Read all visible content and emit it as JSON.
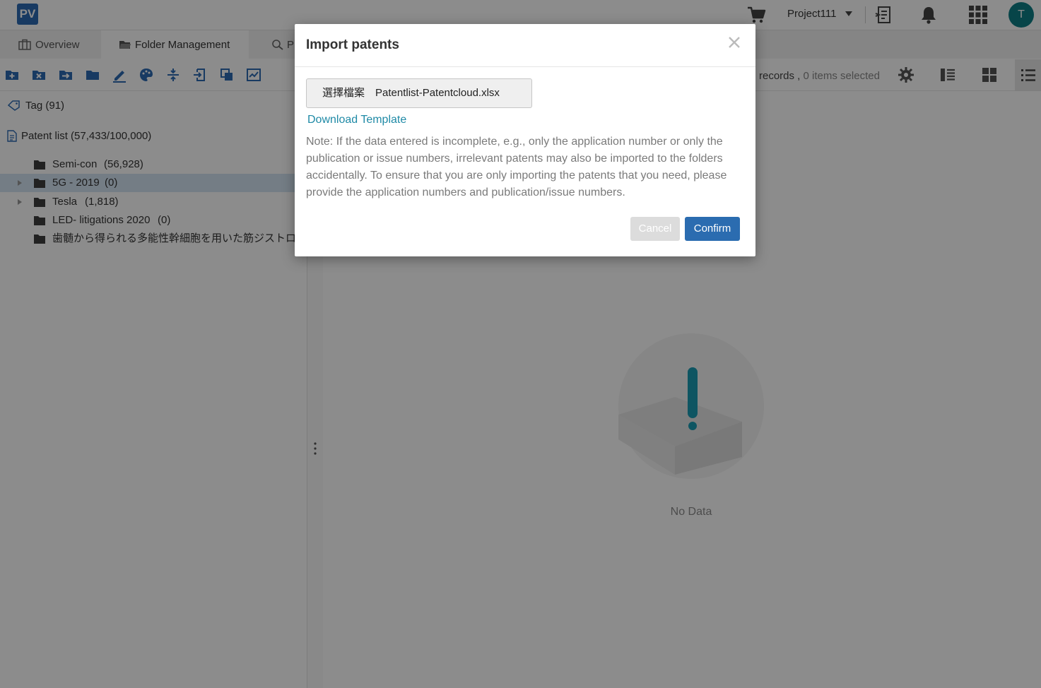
{
  "app": {
    "logo_text": "PV",
    "project_label": "Project111",
    "avatar_initial": "T",
    "accent_color": "#2d6bb3",
    "avatar_color": "#0e7f86"
  },
  "tabs": [
    {
      "label": "Overview",
      "icon": "briefcase-icon"
    },
    {
      "label": "Folder Management",
      "icon": "folder-open-icon",
      "active": true
    },
    {
      "label": "P",
      "icon": "search-icon"
    }
  ],
  "toolbar": {
    "icons": [
      "add-folder-icon",
      "delete-folder-icon",
      "move-folder-icon",
      "folder-icon",
      "edit-icon",
      "palette-icon",
      "merge-icon",
      "import-icon",
      "copy-icon",
      "chart-icon"
    ],
    "records_label": "records ,",
    "selected_label": "0 items selected"
  },
  "sidebar": {
    "tag_label": "Tag (91)",
    "patent_list_label": "Patent list (57,433/100,000)",
    "folders": [
      {
        "name": "Semi-con",
        "count": "(56,928)",
        "expandable": false,
        "highlighted": false
      },
      {
        "name": "5G - 2019",
        "count": "(0)",
        "expandable": true,
        "highlighted": true
      },
      {
        "name": "Tesla",
        "count": "(1,818)",
        "expandable": true,
        "highlighted": false
      },
      {
        "name": "LED- litigations 2020",
        "count": "(0)",
        "expandable": false,
        "highlighted": false
      },
      {
        "name": "歯髄から得られる多能性幹細胞を用いた筋ジストロ",
        "count": "",
        "expandable": false,
        "highlighted": false
      }
    ]
  },
  "content": {
    "empty_label": "No Data"
  },
  "modal": {
    "title": "Import patents",
    "choose_file_label": "選擇檔案",
    "file_name": "Patentlist-Patentcloud.xlsx",
    "download_template_label": "Download Template",
    "note": "Note: If the data entered is incomplete, e.g., only the application number or only the publication or issue numbers, irrelevant patents may also be imported to the folders accidentally. To ensure that you are only importing the patents that you need, please provide the application numbers and publication/issue numbers.",
    "cancel_label": "Cancel",
    "confirm_label": "Confirm",
    "confirm_color": "#2b6cb0",
    "link_color": "#1f8aa6"
  }
}
